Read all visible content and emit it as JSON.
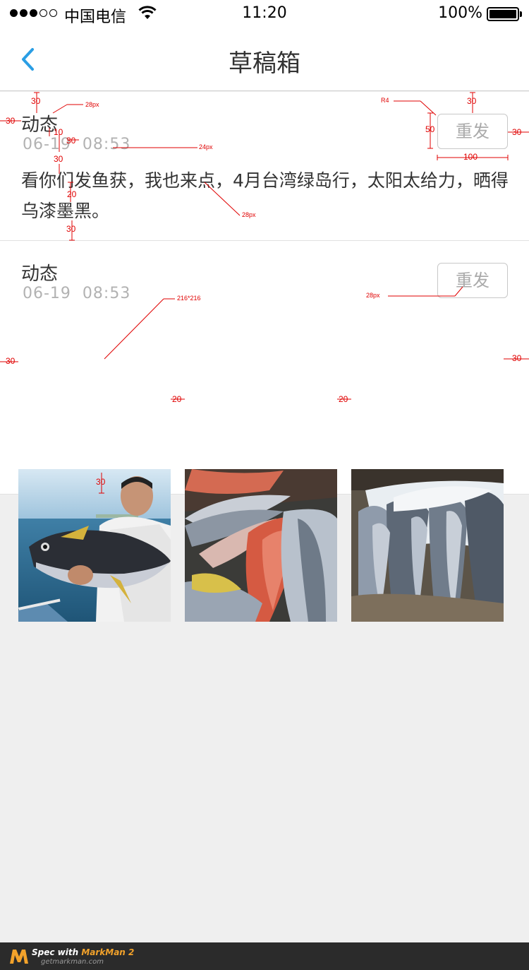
{
  "status_bar": {
    "carrier": "中国电信",
    "time": "11:20",
    "battery": "100%"
  },
  "nav": {
    "title": "草稿箱"
  },
  "drafts": [
    {
      "type": "动态",
      "time": "06-19  08:53",
      "resend_label": "重发",
      "text": "看你们发鱼获，我也来点，4月台湾绿岛行，太阳太给力，晒得乌漆墨黑。"
    },
    {
      "type": "动态",
      "time": "06-19  08:53",
      "resend_label": "重发"
    }
  ],
  "annotations": {
    "font_28": "28px",
    "font_24": "24px",
    "radius": "R4",
    "size_30": "30",
    "size_10": "10",
    "size_20": "20",
    "size_50": "50",
    "size_100": "100",
    "image_size": "216*216"
  },
  "footer": {
    "spec_with": "Spec with ",
    "brand": "MarkMan 2",
    "url": "getmarkman.com"
  }
}
